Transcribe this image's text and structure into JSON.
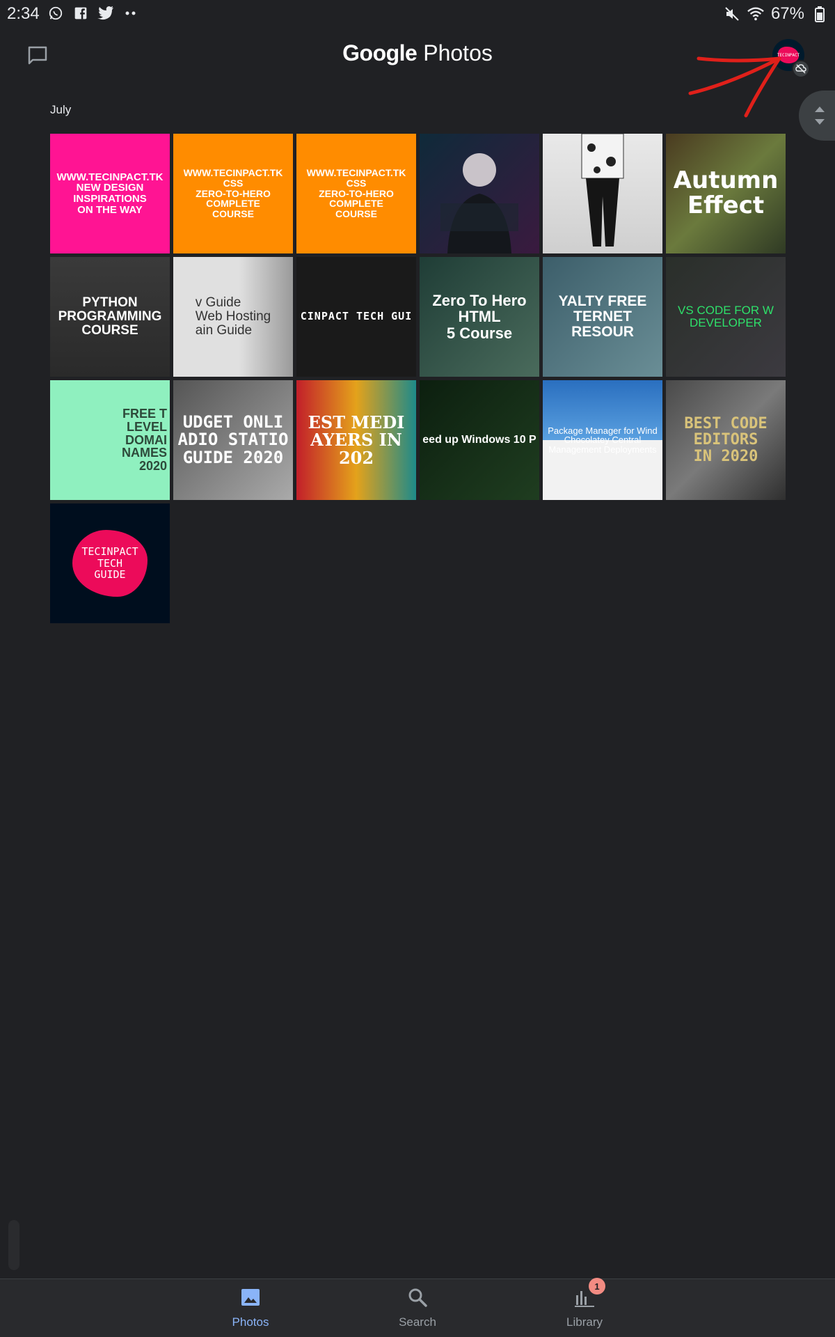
{
  "status_bar": {
    "time": "2:34",
    "left_icons": [
      "whatsapp-icon",
      "facebook-icon",
      "twitter-icon",
      "more-dots-icon"
    ],
    "right_icons": [
      "mute-icon",
      "wifi-icon",
      "battery-icon"
    ],
    "battery": "67%"
  },
  "header": {
    "title_brand": "Google",
    "title_rest": " Photos",
    "avatar_label": "TECINPACT"
  },
  "section": {
    "month": "July"
  },
  "photos": [
    {
      "text": "WWW.TECINPACT.TK\nNEW DESIGN\nINSPIRATIONS\nON THE WAY"
    },
    {
      "text": "WWW.TECINPACT.TK\nCSS\nZERO-TO-HERO\nCOMPLETE\nCOURSE"
    },
    {
      "text": "WWW.TECINPACT.TK\nCSS\nZERO-TO-HERO\nCOMPLETE\nCOURSE"
    },
    {
      "text": ""
    },
    {
      "text": ""
    },
    {
      "text": "Autumn\nEffect"
    },
    {
      "text": "PYTHON\nPROGRAMMING\nCOURSE"
    },
    {
      "text": "v Guide\nWeb Hosting\nain Guide"
    },
    {
      "text": "CINPACT TECH GUI"
    },
    {
      "text": "Zero To Hero\nHTML\n5 Course"
    },
    {
      "text": "YALTY FREE\nTERNET RESOUR"
    },
    {
      "text": "VS CODE FOR W\nDEVELOPER"
    },
    {
      "text": "FREE T\nLEVEL\nDOMAI\nNAMES\n2020"
    },
    {
      "text": "UDGET ONLI\nADIO STATIO\nGUIDE 2020"
    },
    {
      "text": "EST MEDI\nAYERS IN 202"
    },
    {
      "text": "eed up Windows 10 P"
    },
    {
      "text": "Package Manager for Wind\nChocolatey Central Management Deployments"
    },
    {
      "text": "BEST CODE\nEDITORS\nIN 2020"
    },
    {
      "text": "TECINPACT\nTECH\nGUIDE"
    }
  ],
  "bottom_nav": {
    "items": [
      {
        "label": "Photos",
        "icon": "photo-icon",
        "active": true
      },
      {
        "label": "Search",
        "icon": "search-icon",
        "active": false
      },
      {
        "label": "Library",
        "icon": "library-icon",
        "active": false,
        "badge": "1"
      }
    ]
  },
  "colors": {
    "background": "#202124",
    "accent": "#8ab4f8",
    "annotation": "#e0201a",
    "badge": "#f28b82"
  }
}
